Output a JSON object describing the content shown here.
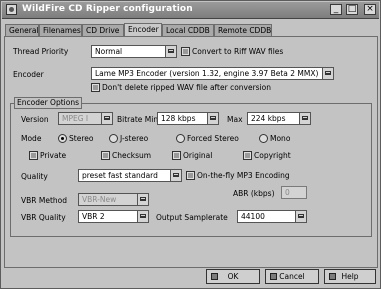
{
  "window": {
    "title": "WildFire CD Ripper configuration",
    "buttons": {
      "minimize": "_",
      "maximize": "□",
      "close": "×"
    }
  },
  "tabs": [
    {
      "label": "General",
      "active": false
    },
    {
      "label": "Filenames",
      "active": false
    },
    {
      "label": "CD Drive",
      "active": false
    },
    {
      "label": "Encoder",
      "active": true
    },
    {
      "label": "Local CDDB",
      "active": false
    },
    {
      "label": "Remote CDDB",
      "active": false
    }
  ],
  "general": {
    "thread_priority_label": "Thread Priority",
    "thread_priority_value": "Normal",
    "convert_riff_label": "Convert to Riff WAV files",
    "encoder_label": "Encoder",
    "encoder_value": "Lame MP3 Encoder (version 1.32, engine 3.97 Beta 2 MMX)",
    "dont_delete_label": "Don't delete ripped WAV file after conversion"
  },
  "encoder_options": {
    "group_title": "Encoder Options",
    "version_label": "Version",
    "version_value": "MPEG I",
    "bitrate_min_label": "Bitrate Min",
    "bitrate_min_value": "128 kbps",
    "max_label": "Max",
    "max_value": "224 kbps",
    "mode_label": "Mode",
    "modes": {
      "stereo": "Stereo",
      "jstereo": "J-stereo",
      "forced": "Forced Stereo",
      "mono": "Mono"
    },
    "private_label": "Private",
    "checksum_label": "Checksum",
    "original_label": "Original",
    "copyright_label": "Copyright",
    "quality_label": "Quality",
    "quality_value": "preset fast standard",
    "onthefly_label": "On-the-fly MP3 Encoding",
    "abr_label": "ABR (kbps)",
    "abr_value": "0",
    "vbr_method_label": "VBR Method",
    "vbr_method_value": "VBR-New",
    "vbr_quality_label": "VBR Quality",
    "vbr_quality_value": "VBR 2",
    "output_samplerate_label": "Output Samplerate",
    "output_samplerate_value": "44100"
  },
  "footer": {
    "ok": "OK",
    "cancel": "Cancel",
    "help": "Help"
  }
}
